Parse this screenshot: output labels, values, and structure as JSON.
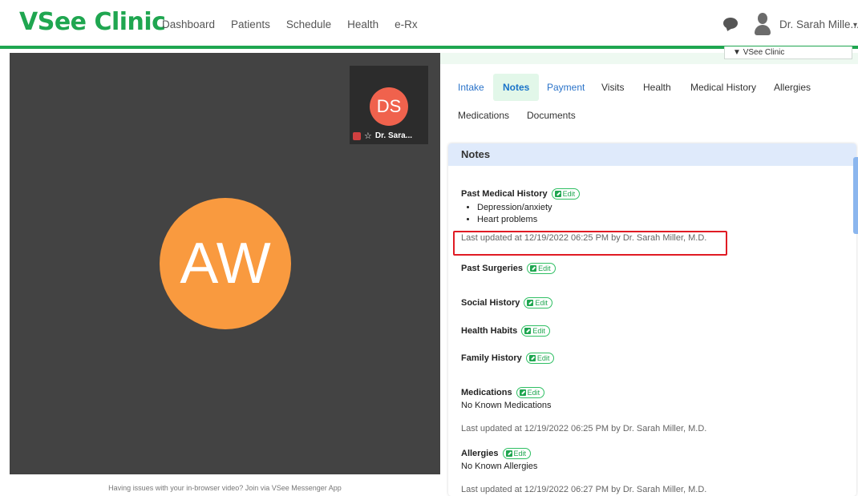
{
  "header": {
    "logo": "VSee Clinic",
    "nav": [
      "Dashboard",
      "Patients",
      "Schedule",
      "Health",
      "e-Rx"
    ],
    "user_name": "Dr. Sarah Mille...",
    "icons": {
      "chat": "chat-bubble-icon",
      "avatar": "user-avatar-icon",
      "caret": "chevron-down-icon"
    },
    "accent": "#1fa650"
  },
  "video": {
    "main_initials": "AW",
    "main_color": "#f99a3f",
    "thumb_initials": "DS",
    "thumb_color": "#f0624d",
    "thumb_name": "Dr. Sara...",
    "help_text": "Having issues with your in-browser video? Join via VSee Messenger App"
  },
  "right": {
    "clinic_select": "VSee Clinic",
    "tabs": [
      "Intake",
      "Notes",
      "Payment",
      "Visits",
      "Health",
      "Medical History",
      "Allergies",
      "Medications",
      "Documents"
    ],
    "active_tab": "Notes",
    "card_title": "Notes",
    "edit_label": "Edit",
    "sections": {
      "past_medical": {
        "title": "Past Medical History",
        "items": [
          "Depression/anxiety",
          "Heart problems"
        ],
        "updated": "Last updated at 12/19/2022 06:25 PM by Dr. Sarah Miller, M.D."
      },
      "past_surgeries": {
        "title": "Past Surgeries"
      },
      "social_history": {
        "title": "Social History"
      },
      "health_habits": {
        "title": "Health Habits"
      },
      "family_history": {
        "title": "Family History"
      },
      "medications": {
        "title": "Medications",
        "value": "No Known Medications",
        "updated": "Last updated at 12/19/2022 06:25 PM by Dr. Sarah Miller, M.D."
      },
      "allergies": {
        "title": "Allergies",
        "value": "No Known Allergies",
        "updated": "Last updated at 12/19/2022 06:27 PM by Dr. Sarah Miller, M.D."
      }
    }
  }
}
